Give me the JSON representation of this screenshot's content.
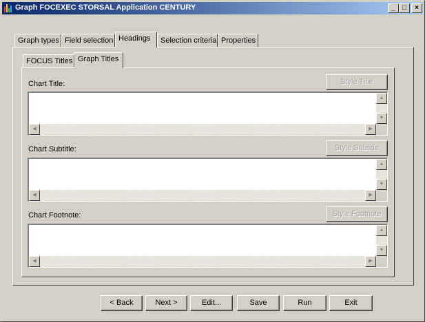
{
  "window": {
    "title": "Graph FOCEXEC STORSAL Application CENTURY",
    "minimize_glyph": "_",
    "maximize_glyph": "□",
    "close_glyph": "×",
    "accent": "#0a246a"
  },
  "tabs": {
    "items": [
      {
        "label": "Graph types"
      },
      {
        "label": "Field selection"
      },
      {
        "label": "Headings"
      },
      {
        "label": "Selection criteria"
      },
      {
        "label": "Properties"
      }
    ],
    "active": "Headings"
  },
  "subtabs": {
    "items": [
      {
        "label": "FOCUS Titles"
      },
      {
        "label": "Graph Titles"
      }
    ],
    "active": "Graph Titles"
  },
  "fields": [
    {
      "label": "Chart Title:",
      "style_button": "Style Title",
      "value": ""
    },
    {
      "label": "Chart Subtitle:",
      "style_button": "Style Subtitle",
      "value": ""
    },
    {
      "label": "Chart Footnote:",
      "style_button": "Style Footnote",
      "value": ""
    }
  ],
  "scroll_glyphs": {
    "up": "▲",
    "down": "▼",
    "left": "◀",
    "right": "▶"
  },
  "footer_buttons": {
    "back": "< Back",
    "next": "Next >",
    "edit": "Edit...",
    "save": "Save",
    "run": "Run",
    "exit": "Exit"
  }
}
